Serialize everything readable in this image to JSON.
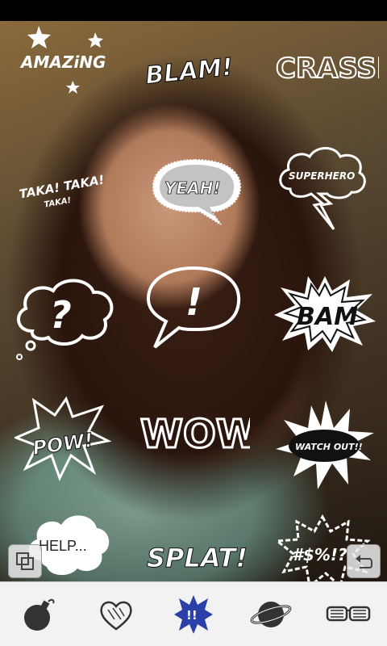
{
  "stickers": {
    "amazing": "AMAZiNG",
    "blam": "BLAM!",
    "crash": "CRASSH",
    "taka_main": "TAKA! TAKA!",
    "taka_small": "TAKA!",
    "yeah": "YEAH!",
    "superhero": "SUPERHERO",
    "question": "?",
    "exclaim": "!",
    "bam": "BAM",
    "pow": "POW!",
    "wow": "WOW",
    "watch_out": "WATCH OUT!!",
    "help": "HELP...",
    "splat": "SPLAT!",
    "symbols": "#$%!?"
  },
  "overlay": {
    "left_icon": "crop-icon",
    "right_icon": "undo-icon"
  },
  "toolbar": {
    "items": [
      {
        "name": "bomb",
        "icon": "bomb-icon"
      },
      {
        "name": "heart",
        "icon": "heart-icon"
      },
      {
        "name": "comic",
        "icon": "comic-burst-icon",
        "label": "!!",
        "selected": true
      },
      {
        "name": "planet",
        "icon": "planet-icon"
      },
      {
        "name": "glasses",
        "icon": "glasses-icon"
      }
    ]
  },
  "colors": {
    "toolbar_bg": "#f2f2f2",
    "selected_burst": "#2b3fa8",
    "sticker": "#ffffff"
  }
}
